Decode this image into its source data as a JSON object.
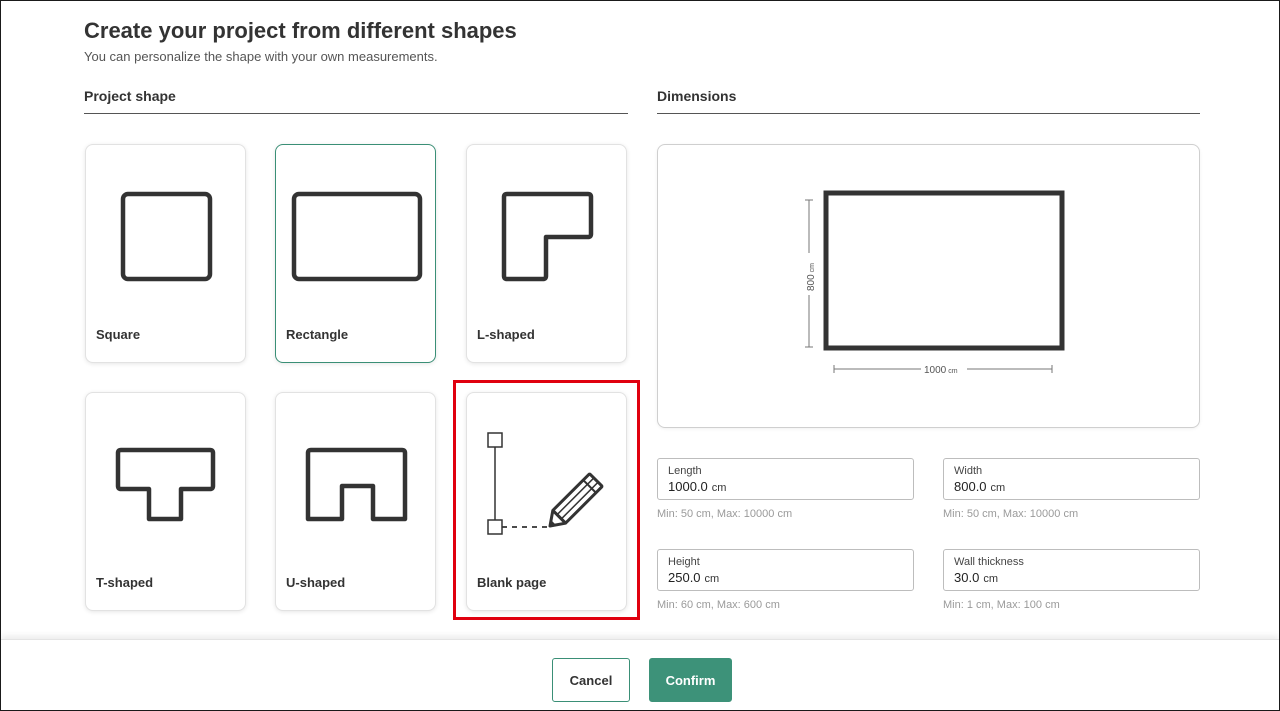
{
  "header": {
    "title": "Create your project from different shapes",
    "subtitle": "You can personalize the shape with your own measurements."
  },
  "sections": {
    "project_shape": "Project shape",
    "dimensions": "Dimensions"
  },
  "shapes": [
    {
      "label": "Square",
      "icon": "square-shape-icon",
      "selected": false
    },
    {
      "label": "Rectangle",
      "icon": "rectangle-shape-icon",
      "selected": true
    },
    {
      "label": "L-shaped",
      "icon": "l-shape-icon",
      "selected": false
    },
    {
      "label": "T-shaped",
      "icon": "t-shape-icon",
      "selected": false
    },
    {
      "label": "U-shaped",
      "icon": "u-shape-icon",
      "selected": false
    },
    {
      "label": "Blank page",
      "icon": "pencil-draw-icon",
      "selected": false
    }
  ],
  "preview": {
    "height_value": "800",
    "width_value": "1000",
    "unit": "cm"
  },
  "fields": {
    "length": {
      "label": "Length",
      "value": "1000.0",
      "unit": "cm",
      "hint": "Min: 50 cm, Max: 10000 cm"
    },
    "width": {
      "label": "Width",
      "value": "800.0",
      "unit": "cm",
      "hint": "Min: 50 cm, Max: 10000 cm"
    },
    "height": {
      "label": "Height",
      "value": "250.0",
      "unit": "cm",
      "hint": "Min: 60 cm, Max: 600 cm"
    },
    "wall_thickness": {
      "label": "Wall thickness",
      "value": "30.0",
      "unit": "cm",
      "hint": "Min: 1 cm, Max: 100 cm"
    }
  },
  "footer": {
    "cancel_label": "Cancel",
    "confirm_label": "Confirm"
  },
  "colors": {
    "accent": "#3d9279",
    "highlight": "#e0000f",
    "shape_stroke": "#333333"
  }
}
